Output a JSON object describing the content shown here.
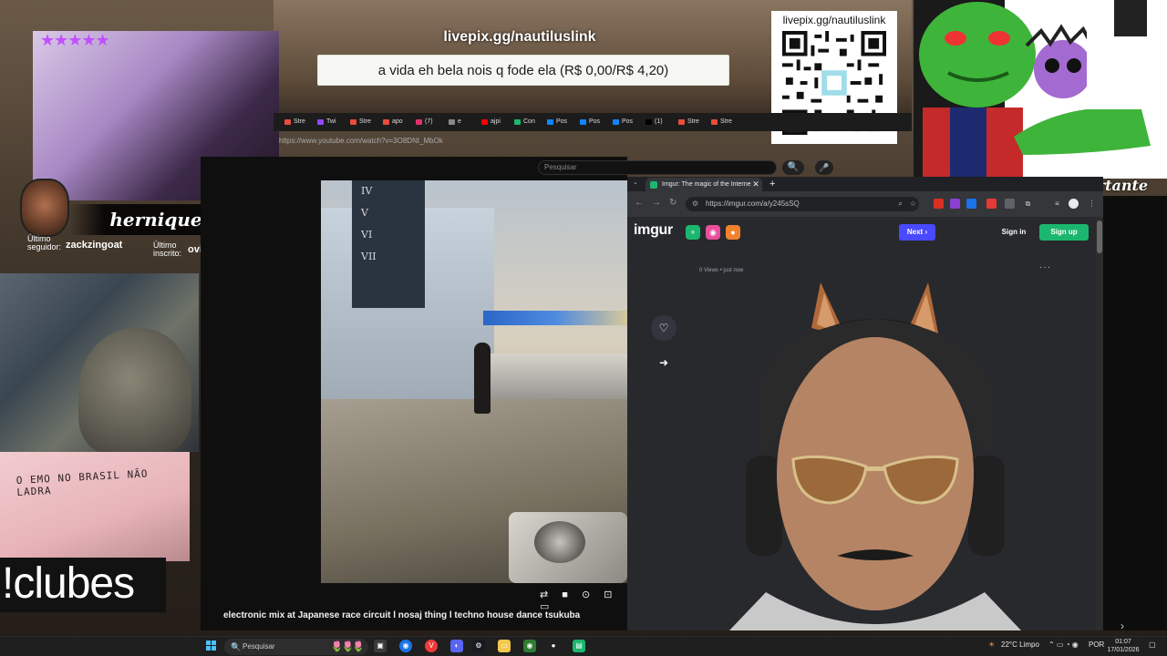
{
  "overlay": {
    "stars": "★★★★★",
    "streamer_name": "hernique",
    "last_follower_label": "Último seguidor:",
    "last_follower_name": "zackzingoat",
    "last_sub_label": "Último inscrito:",
    "last_sub_name": "oviovi_",
    "clubes_text": "!clubes",
    "community_text": "Comunidade é importante",
    "graffiti_text": "O EMO NO BRASIL NÃO LADRA"
  },
  "pix": {
    "url": "livepix.gg/nautiluslink",
    "message": "a vida eh bela nois q fode ela (R$ 0,00/R$ 4,20)",
    "qr_url": "livepix.gg/nautiluslink"
  },
  "left_browser": {
    "tabs": [
      {
        "label": "Stre",
        "color": "#e84d3c"
      },
      {
        "label": "Twi",
        "color": "#9147ff"
      },
      {
        "label": "Stre",
        "color": "#e84d3c"
      },
      {
        "label": "apo",
        "color": "#e84d3c"
      },
      {
        "label": "(7)",
        "color": "#e1306c"
      },
      {
        "label": "e",
        "color": "#888888"
      },
      {
        "label": "ajpi",
        "color": "#ff0000"
      },
      {
        "label": "Con",
        "color": "#1bb76e"
      },
      {
        "label": "Pos",
        "color": "#1185fe"
      },
      {
        "label": "Pos",
        "color": "#1185fe"
      },
      {
        "label": "Pos",
        "color": "#1185fe"
      },
      {
        "label": "(1)",
        "color": "#000000"
      },
      {
        "label": "Stre",
        "color": "#e84d3c"
      },
      {
        "label": "Stre",
        "color": "#e84d3c"
      }
    ],
    "url": "https://www.youtube.com/watch?v=3O8DNt_MbOk"
  },
  "youtube": {
    "search_placeholder": "Pesquisar",
    "search_button": "🔍",
    "mic_icon": "🎤",
    "video_scoreboard": [
      "IV",
      "V",
      "VI",
      "VII"
    ],
    "controls": "⇄ ■ ⊙ ⊡ ▭",
    "title": "electronic mix at Japanese race circuit l nosaj thing l techno house dance tsukuba"
  },
  "right_browser": {
    "tab_title": "Imgur: The magic of the Interne",
    "tab_close": "✕",
    "new_tab": "+",
    "tab_search": "⌄",
    "back": "←",
    "forward": "→",
    "reload": "↻",
    "url": "https://imgur.com/a/y245sSQ",
    "site_info_icon": "⚙"
  },
  "imgur": {
    "logo": "imgur",
    "next_label": "Next ›",
    "signin_label": "Sign in",
    "signup_label": "Sign up",
    "views_text": "0 Views • just now",
    "more_icon": "···",
    "favorite_icon": "♡",
    "share_icon": "➜"
  },
  "taskbar": {
    "search_placeholder": "Pesquisar",
    "search_icon": "🔍",
    "flowers": "🌷🌷🌷",
    "weather": "22°C  Limpo",
    "language": "POR",
    "time": "01:07",
    "date": "17/01/2026"
  },
  "colors": {
    "imgur_green": "#1bb76e",
    "imgur_blue": "#4949ff",
    "chrome_dark": "#202124"
  }
}
